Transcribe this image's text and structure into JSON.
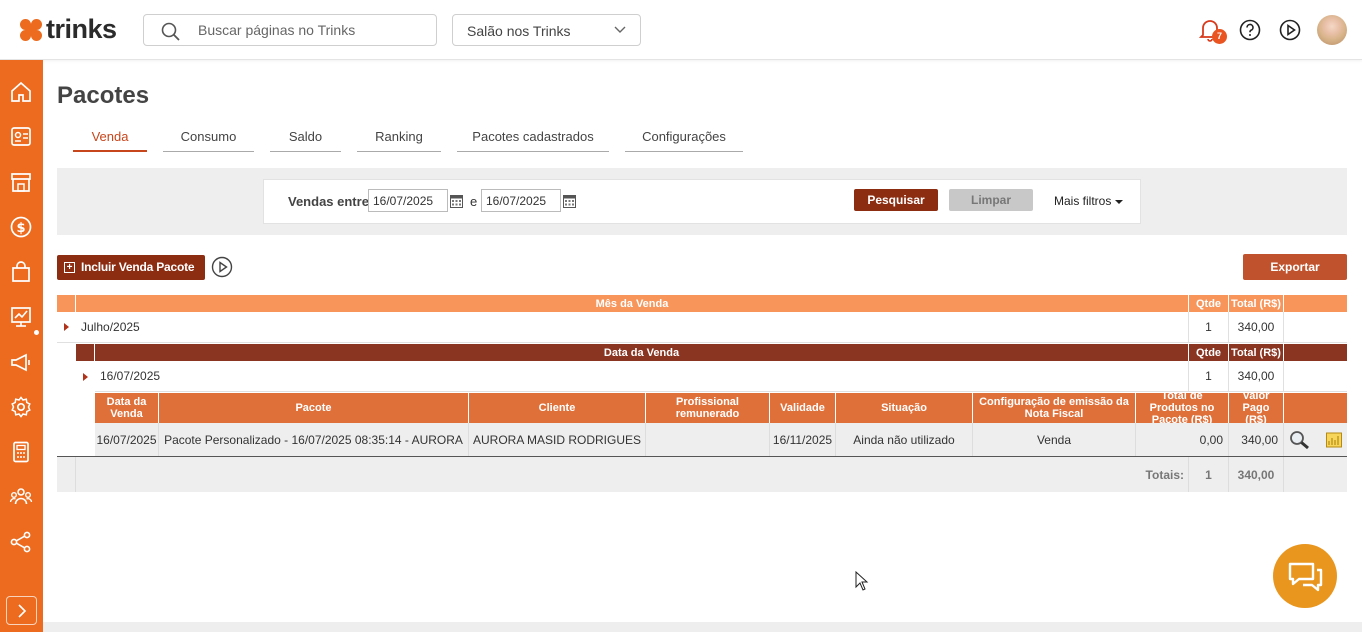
{
  "header": {
    "logo_text": "trinks",
    "search_placeholder": "Buscar páginas no Trinks",
    "salon_selector": "Salão nos Trinks",
    "notification_count": "7"
  },
  "colors": {
    "brand_orange": "#ec6b1e",
    "dark_red": "#8c2d12",
    "table_header": "#f7955b",
    "subheader": "#8a3521"
  },
  "sidebar": {
    "icons": [
      "home-icon",
      "clients-icon",
      "store-icon",
      "dollar-icon",
      "shopping-bag-icon",
      "chart-icon",
      "megaphone-icon",
      "settings-icon",
      "calculator-icon",
      "people-icon",
      "share-icon"
    ],
    "collapse_icon": "chevron-right-icon"
  },
  "page": {
    "title": "Pacotes",
    "tabs": [
      "Venda",
      "Consumo",
      "Saldo",
      "Ranking",
      "Pacotes cadastrados",
      "Configurações"
    ],
    "active_tab": "Venda"
  },
  "filters": {
    "label": "Vendas entre",
    "date_from": "16/07/2025",
    "separator": "e",
    "date_to": "16/07/2025",
    "search_button": "Pesquisar",
    "clear_button": "Limpar",
    "more_filters": "Mais filtros"
  },
  "actions": {
    "include_button": "Incluir Venda Pacote",
    "export_button": "Exportar"
  },
  "table": {
    "level1": {
      "headers": [
        "Mês da Venda",
        "Qtde",
        "Total (R$)"
      ],
      "row": {
        "month": "Julho/2025",
        "qty": "1",
        "total": "340,00"
      }
    },
    "level2": {
      "headers": [
        "Data da Venda",
        "Qtde",
        "Total (R$)"
      ],
      "row": {
        "date": "16/07/2025",
        "qty": "1",
        "total": "340,00"
      }
    },
    "level3": {
      "headers": [
        "Data da Venda",
        "Pacote",
        "Cliente",
        "Profissional remunerado",
        "Validade",
        "Situação",
        "Configuração de emissão da Nota Fiscal",
        "Total de Produtos no Pacote (R$)",
        "Valor Pago (R$)"
      ],
      "row": {
        "date": "16/07/2025",
        "package": "Pacote Personalizado - 16/07/2025 08:35:14 - AURORA",
        "client": "AURORA MASID RODRIGUES",
        "professional": "",
        "validity": "16/11/2025",
        "status": "Ainda não utilizado",
        "invoice_config": "Venda",
        "products_total": "0,00",
        "paid": "340,00"
      }
    },
    "totals": {
      "label": "Totais:",
      "qty": "1",
      "total": "340,00"
    }
  }
}
